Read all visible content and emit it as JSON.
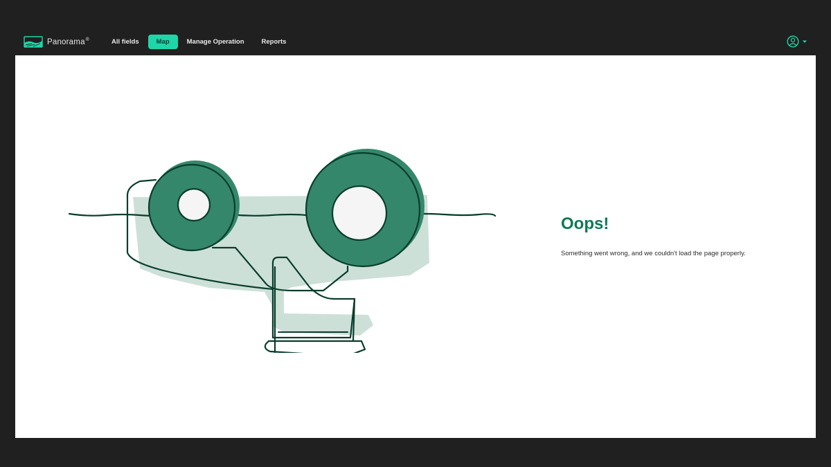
{
  "header": {
    "brand": {
      "name": "Panorama",
      "mark": "®",
      "logo_icon": "field-landscape-icon"
    },
    "nav": [
      {
        "label": "All fields",
        "active": false
      },
      {
        "label": "Map",
        "active": true
      },
      {
        "label": "Manage Operation",
        "active": false
      },
      {
        "label": "Reports",
        "active": false
      }
    ],
    "user": {
      "icon": "user-circle-icon",
      "caret_icon": "caret-down-icon"
    }
  },
  "error": {
    "title": "Oops!",
    "message": "Something went wrong, and we couldn't load the page properly."
  },
  "colors": {
    "background": "#202020",
    "accent": "#1fd6a9",
    "title": "#0d7a56",
    "illustration_dark": "#083d2b",
    "illustration_fill": "#35876c",
    "illustration_light": "#cce0d8"
  }
}
